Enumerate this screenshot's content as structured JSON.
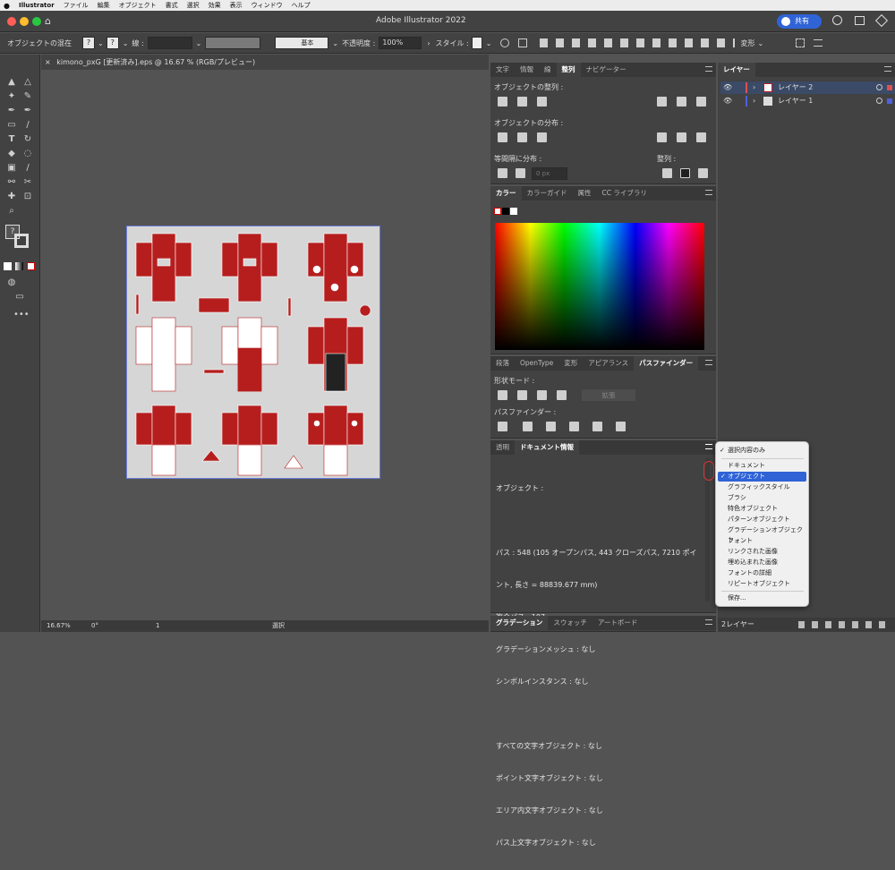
{
  "menubar": {
    "app": "Illustrator",
    "items": [
      "ファイル",
      "編集",
      "オブジェクト",
      "書式",
      "選択",
      "効果",
      "表示",
      "ウィンドウ",
      "ヘルプ"
    ]
  },
  "titlebar": {
    "title": "Adobe Illustrator 2022",
    "share": "共有"
  },
  "control": {
    "mode": "オブジェクトの混在",
    "stroke": "線 :",
    "stroke_style": "基本",
    "opacity_label": "不透明度 :",
    "opacity": "100%",
    "style_label": "スタイル :",
    "transform": "変形"
  },
  "document": {
    "tab": "kimono_pxG [更新済み].eps @ 16.67 % (RGB/プレビュー)",
    "zoom": "16.67%",
    "angle": "0°",
    "page": "1",
    "status": "選択"
  },
  "align_panel": {
    "tabs": [
      "文字",
      "情報",
      "線",
      "整列",
      "ナビゲーター"
    ],
    "active": "整列",
    "align_objects": "オブジェクトの整列 :",
    "distribute_objects": "オブジェクトの分布 :",
    "distribute_spacing": "等間隔に分布 :",
    "align_to": "整列 :",
    "spacing_value": "0 px"
  },
  "color_panel": {
    "tabs": [
      "カラー",
      "カラーガイド",
      "属性",
      "CC ライブラリ"
    ],
    "active": "カラー"
  },
  "pathfinder_panel": {
    "tabs": [
      "段落",
      "OpenType",
      "変形",
      "アピアランス",
      "パスファインダー"
    ],
    "active": "パスファインダー",
    "shape_modes": "形状モード :",
    "expand": "拡張",
    "pathfinders": "パスファインダー :"
  },
  "docinfo_panel": {
    "tabs": [
      "透明",
      "ドキュメント情報"
    ],
    "active": "ドキュメント情報",
    "lines": [
      "オブジェクト :",
      "",
      "パス : 548 (105 オープンパス, 443 クローズパス, 7210 ポイ",
      "ント, 長さ = 88839.677 mm)",
      "複合パス : 107",
      "グラデーションメッシュ : なし",
      "シンボルインスタンス : なし",
      "",
      "すべての文字オブジェクト : なし",
      "ポイント文字オブジェクト : なし",
      "エリア内文字オブジェクト : なし",
      "パス上文字オブジェクト : なし"
    ]
  },
  "bottom_panel": {
    "tabs": [
      "グラデーション",
      "スウォッチ",
      "アートボード"
    ],
    "active": "グラデーション"
  },
  "layers_panel": {
    "title": "レイヤー",
    "layers": [
      {
        "name": "レイヤー 2",
        "color": "#e05050"
      },
      {
        "name": "レイヤー 1",
        "color": "#5060e0"
      }
    ],
    "footer": "2レイヤー"
  },
  "flyout_menu": {
    "items": [
      "選択内容のみ",
      "ドキュメント",
      "オブジェクト",
      "グラフィックスタイル",
      "ブラシ",
      "特色オブジェクト",
      "パターンオブジェクト",
      "グラデーションオブジェクト",
      "フォント",
      "リンクされた画像",
      "埋め込まれた画像",
      "フォントの詳細",
      "リピートオブジェクト",
      "保存..."
    ],
    "checked": [
      "選択内容のみ",
      "オブジェクト"
    ],
    "selected": "オブジェクト"
  },
  "colors": {
    "kimono_red": "#b61e1e",
    "accent_blue": "#2f63d6",
    "panel": "#424242"
  }
}
